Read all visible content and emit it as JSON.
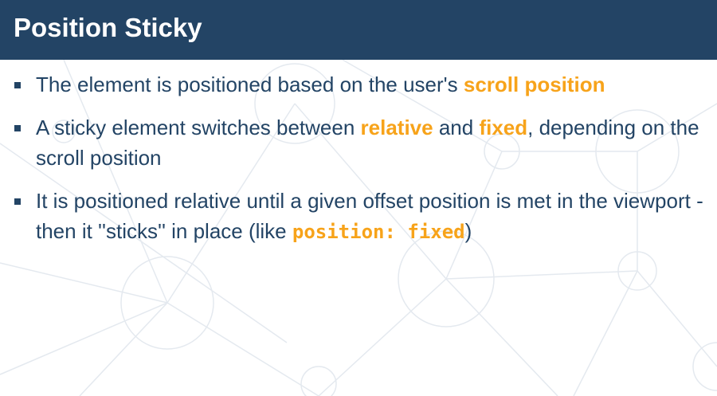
{
  "slide": {
    "title": "Position Sticky",
    "colors": {
      "header_background": "#234465",
      "body_text": "#234465",
      "highlight": "#f7a31a",
      "background_pattern": "#e3e8ee"
    },
    "bullets": [
      {
        "before": "The element is positioned based on the user's ",
        "highlight": "scroll position",
        "after": ""
      },
      {
        "before": "A sticky element switches between ",
        "highlight_1": "relative",
        "middle": " and ",
        "highlight_2": "fixed",
        "after": ", depending on the scroll position"
      },
      {
        "before": "It is positioned relative until a given offset position is met in the viewport - then it ''sticks'' in place (like ",
        "code": "position: fixed",
        "after": ")"
      }
    ]
  }
}
